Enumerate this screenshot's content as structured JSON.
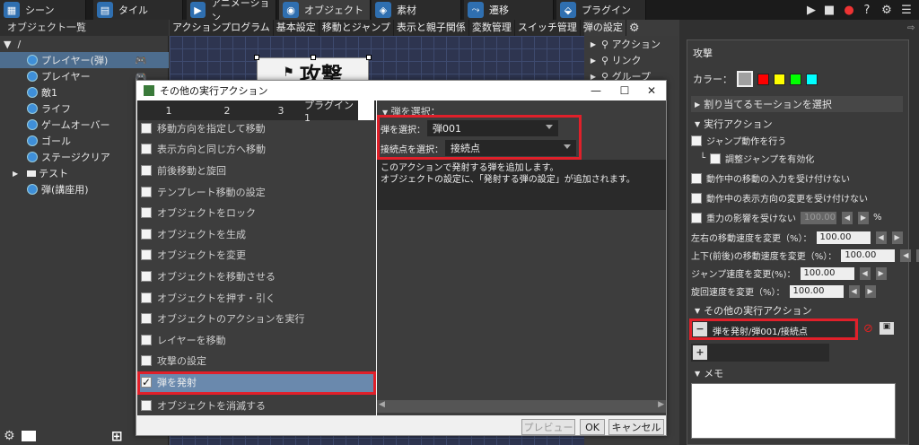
{
  "topbar": {
    "tabs": [
      {
        "label": "シーン",
        "icon": "scene-icon"
      },
      {
        "label": "タイル",
        "icon": "tile-icon"
      },
      {
        "label": "アニメーション",
        "icon": "animation-icon"
      },
      {
        "label": "オブジェクト",
        "icon": "object-icon",
        "active": true
      },
      {
        "label": "素材",
        "icon": "material-icon"
      },
      {
        "label": "遷移",
        "icon": "transition-icon"
      },
      {
        "label": "プラグイン",
        "icon": "plugin-icon"
      }
    ]
  },
  "object_list": {
    "title": "オブジェクト一覧",
    "root": "/",
    "items": [
      "プレイヤー(弾)",
      "プレイヤー",
      "敵1",
      "ライフ",
      "ゲームオーバー",
      "ゴール",
      "ステージクリア",
      "テスト",
      "弾(講座用)"
    ],
    "selected": "プレイヤー(弾)"
  },
  "editor": {
    "tabs": [
      "アクションプログラム",
      "基本設定",
      "移動とジャンプ",
      "表示と親子関係",
      "変数管理",
      "スイッチ管理",
      "弾の設定"
    ],
    "node_label": "攻撃"
  },
  "link_panel": {
    "items": [
      "アクション",
      "リンク",
      "グループ"
    ]
  },
  "dialog": {
    "title": "その他の実行アクション",
    "tabs": [
      "1",
      "2",
      "3",
      "プラグイン1"
    ],
    "actions": [
      "移動方向を指定して移動",
      "表示方向と同じ方へ移動",
      "前後移動と旋回",
      "テンプレート移動の設定",
      "オブジェクトをロック",
      "オブジェクトを生成",
      "オブジェクトを変更",
      "オブジェクトを移動させる",
      "オブジェクトを押す・引く",
      "オブジェクトのアクションを実行",
      "レイヤーを移動",
      "攻撃の設定",
      "弾を発射",
      "オブジェクトを消滅する"
    ],
    "selected_action": "弾を発射",
    "section_title": "弾を選択：",
    "bullet_label": "弾を選択：",
    "bullet_value": "弾001",
    "conn_label": "接続点を選択：",
    "conn_value": "接続点",
    "description": "このアクションで発射する弾を追加します。\nオブジェクトの設定に、「発射する弾の設定」が追加されます。",
    "preview_button": "プレビュー",
    "ok_button": "OK",
    "cancel_button": "キャンセル"
  },
  "right_panel": {
    "title": "攻撃",
    "color_label": "カラー：",
    "colors": [
      "#a0a0a0",
      "#ff0000",
      "#ffff00",
      "#00ff00",
      "#00ffff"
    ],
    "motion_section": "割り当てるモーションを選択",
    "exec_section": "実行アクション",
    "checks": [
      "ジャンプ動作を行う",
      "調整ジャンプを有効化",
      "動作中の移動の入力を受け付けない",
      "動作中の表示方向の変更を受け付けない",
      "重力の影響を受けない"
    ],
    "gravity_value": "100.00",
    "gravity_unit": "%",
    "speeds": [
      {
        "label": "左右の移動速度を変更（%）：",
        "value": "100.00"
      },
      {
        "label": "上下(前後)の移動速度を変更（%）：",
        "value": "100.00"
      },
      {
        "label": "ジャンプ速度を変更(%)：",
        "value": "100.00"
      },
      {
        "label": "旋回速度を変更（%）：",
        "value": "100.00"
      }
    ],
    "other_section": "その他の実行アクション",
    "other_action": "弾を発射/弾001/接続点",
    "memo_section": "メモ"
  }
}
